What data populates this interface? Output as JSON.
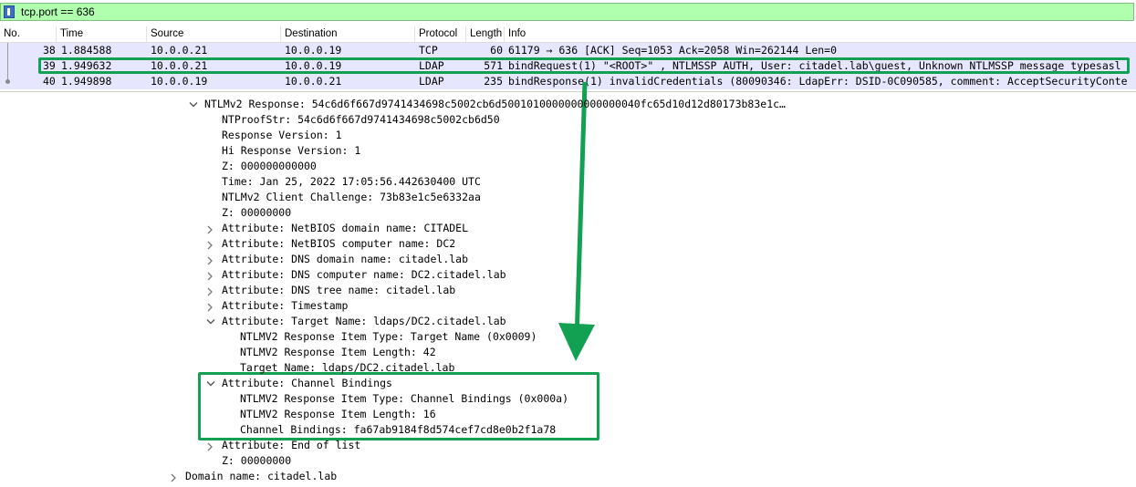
{
  "filter": {
    "value": "tcp.port == 636"
  },
  "columns": [
    "No.",
    "Time",
    "Source",
    "Destination",
    "Protocol",
    "Length",
    "Info"
  ],
  "packets": [
    {
      "no": "38",
      "time": "1.884588",
      "source": "10.0.0.21",
      "destination": "10.0.0.19",
      "protocol": "TCP",
      "length": "60",
      "info": "61179 → 636 [ACK] Seq=1053 Ack=2058 Win=262144 Len=0"
    },
    {
      "no": "39",
      "time": "1.949632",
      "source": "10.0.0.21",
      "destination": "10.0.0.19",
      "protocol": "LDAP",
      "length": "571",
      "info": "bindRequest(1) \"<ROOT>\" , NTLMSSP_AUTH, User: citadel.lab\\guest, Unknown NTLMSSP message typesasl"
    },
    {
      "no": "40",
      "time": "1.949898",
      "source": "10.0.0.19",
      "destination": "10.0.0.21",
      "protocol": "LDAP",
      "length": "235",
      "info": "bindResponse(1) invalidCredentials (80090346: LdapErr: DSID-0C090585, comment: AcceptSecurityConte"
    }
  ],
  "detail_lines": [
    "NTLMv2 Response: 54c6d6f667d9741434698c5002cb6d5001010000000000000040fc65d10d12d80173b83e1c…",
    "NTProofStr: 54c6d6f667d9741434698c5002cb6d50",
    "Response Version: 1",
    "Hi Response Version: 1",
    "Z: 000000000000",
    "Time: Jan 25, 2022 17:05:56.442630400 UTC",
    "NTLMv2 Client Challenge: 73b83e1c5e6332aa",
    "Z: 00000000",
    "Attribute: NetBIOS domain name: CITADEL",
    "Attribute: NetBIOS computer name: DC2",
    "Attribute: DNS domain name: citadel.lab",
    "Attribute: DNS computer name: DC2.citadel.lab",
    "Attribute: DNS tree name: citadel.lab",
    "Attribute: Timestamp",
    "Attribute: Target Name: ldaps/DC2.citadel.lab",
    "NTLMV2 Response Item Type: Target Name (0x0009)",
    "NTLMV2 Response Item Length: 42",
    "Target Name: ldaps/DC2.citadel.lab",
    "Attribute: Channel Bindings",
    "NTLMV2 Response Item Type: Channel Bindings (0x000a)",
    "NTLMV2 Response Item Length: 16",
    "Channel Bindings: fa67ab9184f8d574cef7cd8e0b2f1a78",
    "Attribute: End of list",
    "Z: 00000000",
    "Domain name: citadel.lab"
  ],
  "detail_twisties": [
    "down",
    "none",
    "none",
    "none",
    "none",
    "none",
    "none",
    "none",
    "right",
    "right",
    "right",
    "right",
    "right",
    "right",
    "down",
    "none",
    "none",
    "none",
    "down",
    "none",
    "none",
    "none",
    "right",
    "none",
    "right"
  ],
  "colors": {
    "filter_ok": "#afffaf",
    "row_bg": "#e7e6ff",
    "annotation": "#12a052"
  },
  "icons": [
    "bookmark-icon",
    "expand-arrow-icon",
    "collapse-arrow-icon",
    "annotation-arrow-icon"
  ]
}
